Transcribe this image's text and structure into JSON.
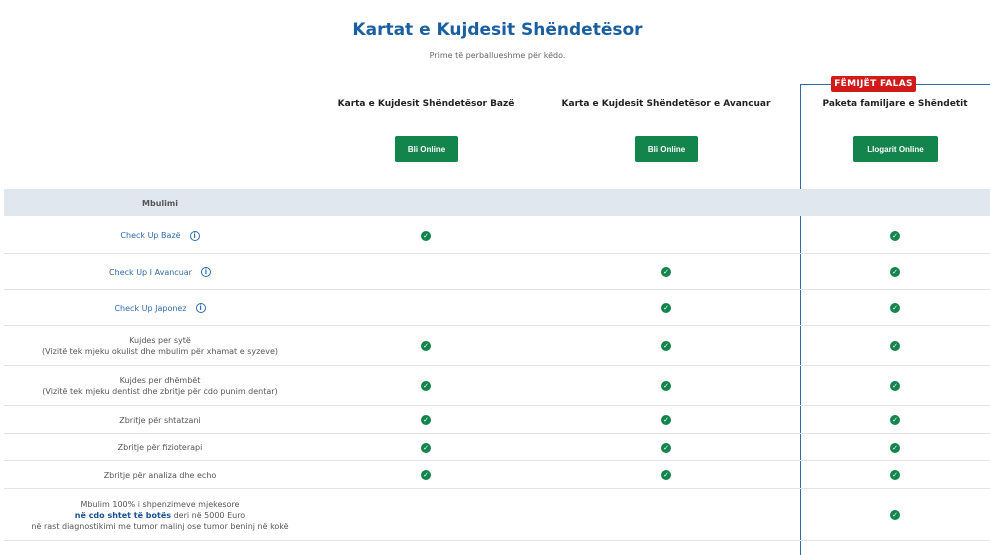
{
  "header": {
    "title": "Kartat e Kujdesit Shëndetësor",
    "subtitle": "Prime të perballueshme për këdo."
  },
  "badge": "FËMIJËT FALAS",
  "plans": [
    {
      "name": "Karta e Kujdesit Shëndetësor Bazë",
      "button": "Bli Online"
    },
    {
      "name": "Karta e Kujdesit Shëndetësor e Avancuar",
      "button": "Bli Online"
    },
    {
      "name": "Paketa familjare e Shëndetit",
      "button": "Llogarit Online"
    }
  ],
  "section_label": "Mbulimi",
  "info_icon": "info-icon",
  "check_icon": "check-circle-icon",
  "colors": {
    "accent_blue": "#1a5fa0",
    "button_green": "#12844c",
    "badge_red": "#d11a1a",
    "section_bg": "#e1e7ef"
  },
  "features": [
    {
      "label": "Check Up Bazë",
      "link": true,
      "info": true,
      "checks": [
        true,
        false,
        true
      ]
    },
    {
      "label": "Check Up I Avancuar",
      "link": true,
      "info": true,
      "checks": [
        false,
        true,
        true
      ]
    },
    {
      "label": "Check Up Japonez",
      "link": true,
      "info": true,
      "checks": [
        false,
        true,
        true
      ]
    },
    {
      "label": "Kujdes per sytë",
      "sub": "(Vizitë tek mjeku okulist dhe mbulim për xhamat e syzeve)",
      "checks": [
        true,
        true,
        true
      ]
    },
    {
      "label": "Kujdes per dhëmbët",
      "sub": "(Vizitë tek mjeku dentist dhe zbritje për cdo punim dentar)",
      "checks": [
        true,
        true,
        true
      ]
    },
    {
      "label": "Zbritje për shtatzani",
      "checks": [
        true,
        true,
        true
      ]
    },
    {
      "label": "Zbritje për fizioterapi",
      "checks": [
        true,
        true,
        true
      ]
    },
    {
      "label": "Zbritje për analiza dhe echo",
      "checks": [
        true,
        true,
        true
      ]
    },
    {
      "label": "Mbulim 100% i shpenzimeve mjekesore",
      "emph": "në cdo shtet të botës",
      "emph_tail": " deri në 5000 Euro",
      "sub": "në rast diagnostikimi me tumor malinj ose tumor beninj në kokë",
      "checks": [
        false,
        false,
        true
      ]
    }
  ]
}
